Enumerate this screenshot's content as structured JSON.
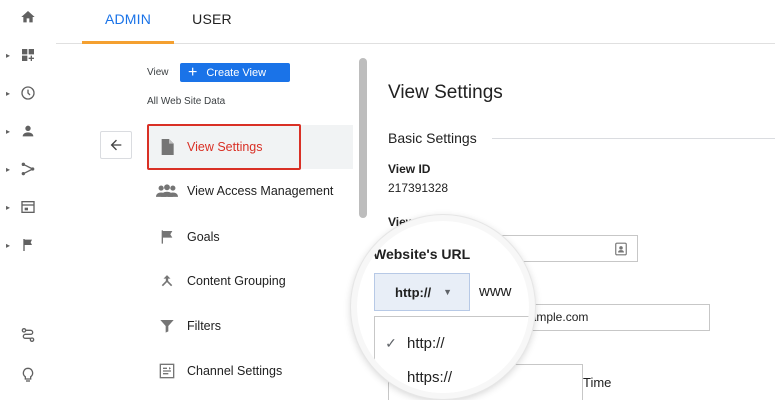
{
  "tabs": {
    "admin": "ADMIN",
    "user": "USER"
  },
  "view_column": {
    "label": "View",
    "create_button": "Create View",
    "site_data": "All Web Site Data",
    "items": [
      {
        "label": "View Settings",
        "icon": "document-icon",
        "active": true
      },
      {
        "label": "View Access Management",
        "icon": "people-icon"
      },
      {
        "label": "Goals",
        "icon": "flag-icon"
      },
      {
        "label": "Content Grouping",
        "icon": "merge-icon"
      },
      {
        "label": "Filters",
        "icon": "filter-icon"
      },
      {
        "label": "Channel Settings",
        "icon": "channel-icon"
      }
    ]
  },
  "panel": {
    "title": "View Settings",
    "section": "Basic Settings",
    "view_id_label": "View ID",
    "view_id_value": "217391328",
    "view_name_label": "View Name",
    "url_value": "example.com",
    "time_text": "Time"
  },
  "magnifier": {
    "title": "Website's URL",
    "protocol_selected": "http://",
    "www_text": "www",
    "options": [
      "http://",
      "https://"
    ]
  },
  "colors": {
    "accent": "#1a73e8",
    "highlight": "#d93025",
    "tab_indicator": "#f4a030"
  }
}
